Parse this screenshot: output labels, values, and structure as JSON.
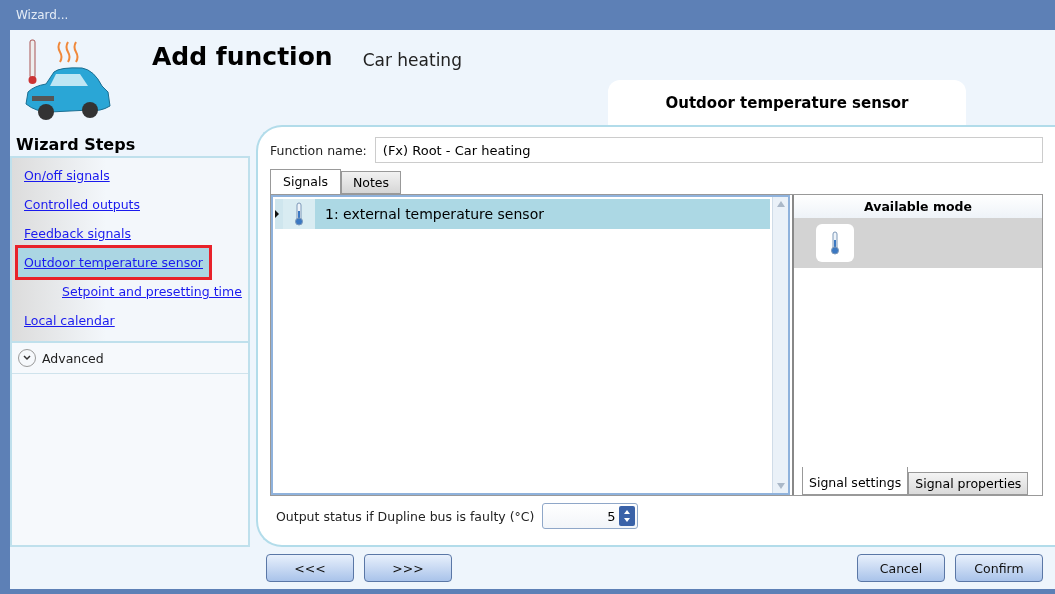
{
  "window": {
    "title": "Wizard..."
  },
  "header": {
    "title": "Add function",
    "subtitle": "Car heating",
    "step_title": "Outdoor temperature sensor"
  },
  "sidebar": {
    "title": "Wizard Steps",
    "items": [
      {
        "label": "On/off signals",
        "selected": false
      },
      {
        "label": "Controlled outputs",
        "selected": false
      },
      {
        "label": "Feedback signals",
        "selected": false
      },
      {
        "label": "Outdoor temperature sensor",
        "selected": true,
        "children": [
          {
            "label": "Setpoint and presetting time",
            "selected": false
          }
        ]
      },
      {
        "label": "Local calendar",
        "selected": false
      }
    ],
    "advanced": {
      "label": "Advanced",
      "expanded": false
    }
  },
  "function_name": {
    "label": "Function name:",
    "value": "(Fx) Root - Car heating"
  },
  "tabs": [
    {
      "label": "Signals",
      "selected": true
    },
    {
      "label": "Notes",
      "selected": false
    }
  ],
  "signals": [
    {
      "label": "1: external temperature sensor",
      "selected": true
    }
  ],
  "modes": {
    "title": "Available mode",
    "items": [
      {
        "selected": true
      }
    ]
  },
  "side_tabs": [
    {
      "label": "Signal settings",
      "selected": true
    },
    {
      "label": "Signal properties",
      "selected": false
    }
  ],
  "output_status": {
    "label": "Output status if Dupline bus is faulty (°C)",
    "value": "5"
  },
  "buttons": {
    "back": "<<<",
    "next": ">>>",
    "cancel": "Cancel",
    "confirm": "Confirm"
  }
}
